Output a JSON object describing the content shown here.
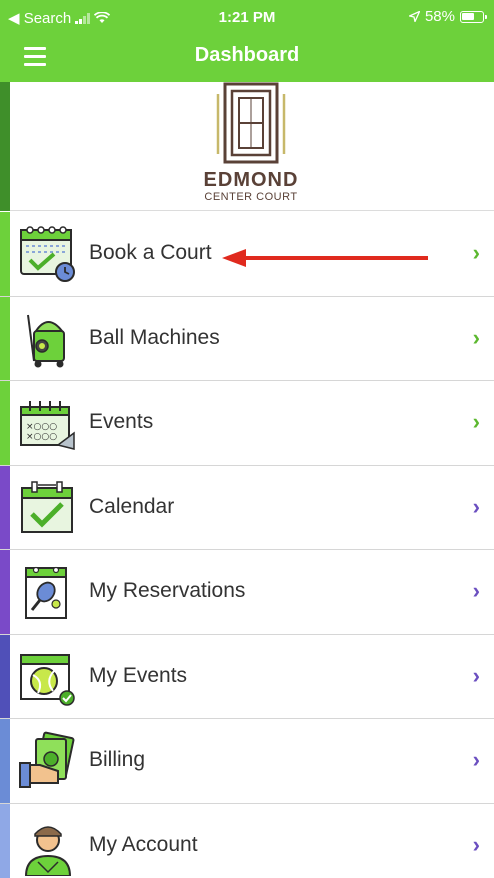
{
  "status_bar": {
    "back_label": "◀ Search",
    "time": "1:21 PM",
    "battery": "58%"
  },
  "nav": {
    "title": "Dashboard"
  },
  "logo": {
    "name": "EDMOND",
    "subtitle": "CENTER COURT"
  },
  "colors": {
    "green": "#6dd13b",
    "purple": "#7a4ac8",
    "blue": "#6b8cd6",
    "chevron_green": "#5cb82f",
    "chevron_purple": "#6b4fc0"
  },
  "menu": {
    "items": [
      {
        "label": "Book a Court",
        "icon": "calendar-clock-icon"
      },
      {
        "label": "Ball Machines",
        "icon": "ball-machine-icon"
      },
      {
        "label": "Events",
        "icon": "tournament-board-icon"
      },
      {
        "label": "Calendar",
        "icon": "calendar-check-icon"
      },
      {
        "label": "My Reservations",
        "icon": "racket-calendar-icon"
      },
      {
        "label": "My Events",
        "icon": "tennis-ball-calendar-icon"
      },
      {
        "label": "Billing",
        "icon": "money-hand-icon"
      },
      {
        "label": "My Account",
        "icon": "user-avatar-icon"
      }
    ]
  }
}
